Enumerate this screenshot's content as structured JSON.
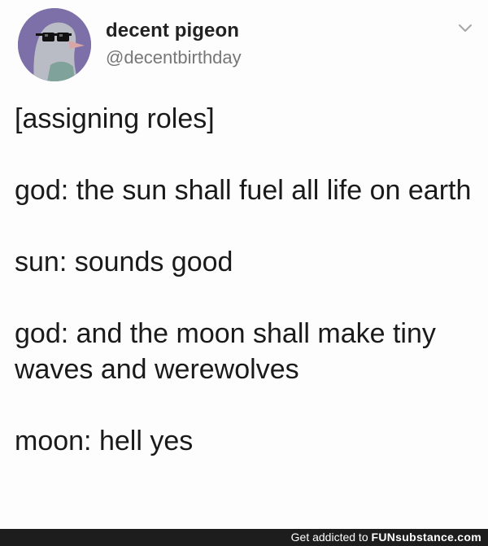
{
  "tweet": {
    "display_name": "decent pigeon",
    "handle": "@decentbirthday",
    "avatar_icon": "pigeon-with-sunglasses-icon",
    "menu_icon": "chevron-down-icon",
    "paragraphs": [
      "[assigning roles]",
      "god: the sun shall fuel all life on earth",
      "sun: sounds good",
      "god: and the moon shall make tiny waves and werewolves",
      "moon: hell yes"
    ]
  },
  "footer": {
    "prefix": "Get addicted to",
    "brand": "FUNsubstance.com"
  },
  "colors": {
    "avatar_bg": "#7d6fa7",
    "footer_bg": "#1d1d1d",
    "handle_text": "#777777"
  }
}
